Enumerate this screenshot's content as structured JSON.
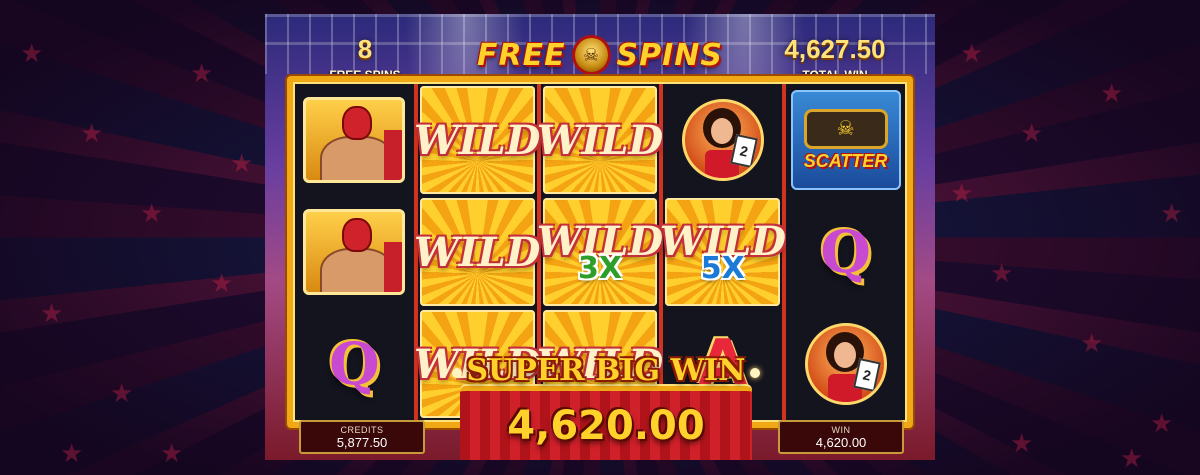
{
  "header": {
    "free_spins_count": "8",
    "free_spins_label": "FREE SPINS",
    "logo_left": "FREE",
    "logo_right": "SPINS",
    "total_win_value": "4,627.50",
    "total_win_label": "TOTAL WIN"
  },
  "reels": [
    [
      "wrestler",
      "wrestler",
      "Q"
    ],
    [
      "WILD",
      "WILD",
      "WILD"
    ],
    [
      "WILD",
      "WILD 3X",
      "WILD"
    ],
    [
      "girl",
      "WILD 5X",
      "A"
    ],
    [
      "SCATTER",
      "Q",
      "girl"
    ]
  ],
  "symbols": {
    "wild_text": "WILD",
    "mult_3x": "3X",
    "mult_5x": "5X",
    "queen": "Q",
    "ace": "A",
    "scatter_text": "SCATTER",
    "card_value": "2"
  },
  "win_banner": {
    "title": "SUPER BIG WIN",
    "amount": "4,620.00"
  },
  "footer": {
    "credits_label": "CREDITS",
    "credits_value": "5,877.50",
    "win_label": "WIN",
    "win_value": "4,620.00"
  },
  "colors": {
    "gold": "#ffd12a",
    "frame": "#f0a915",
    "red": "#d0202a"
  }
}
